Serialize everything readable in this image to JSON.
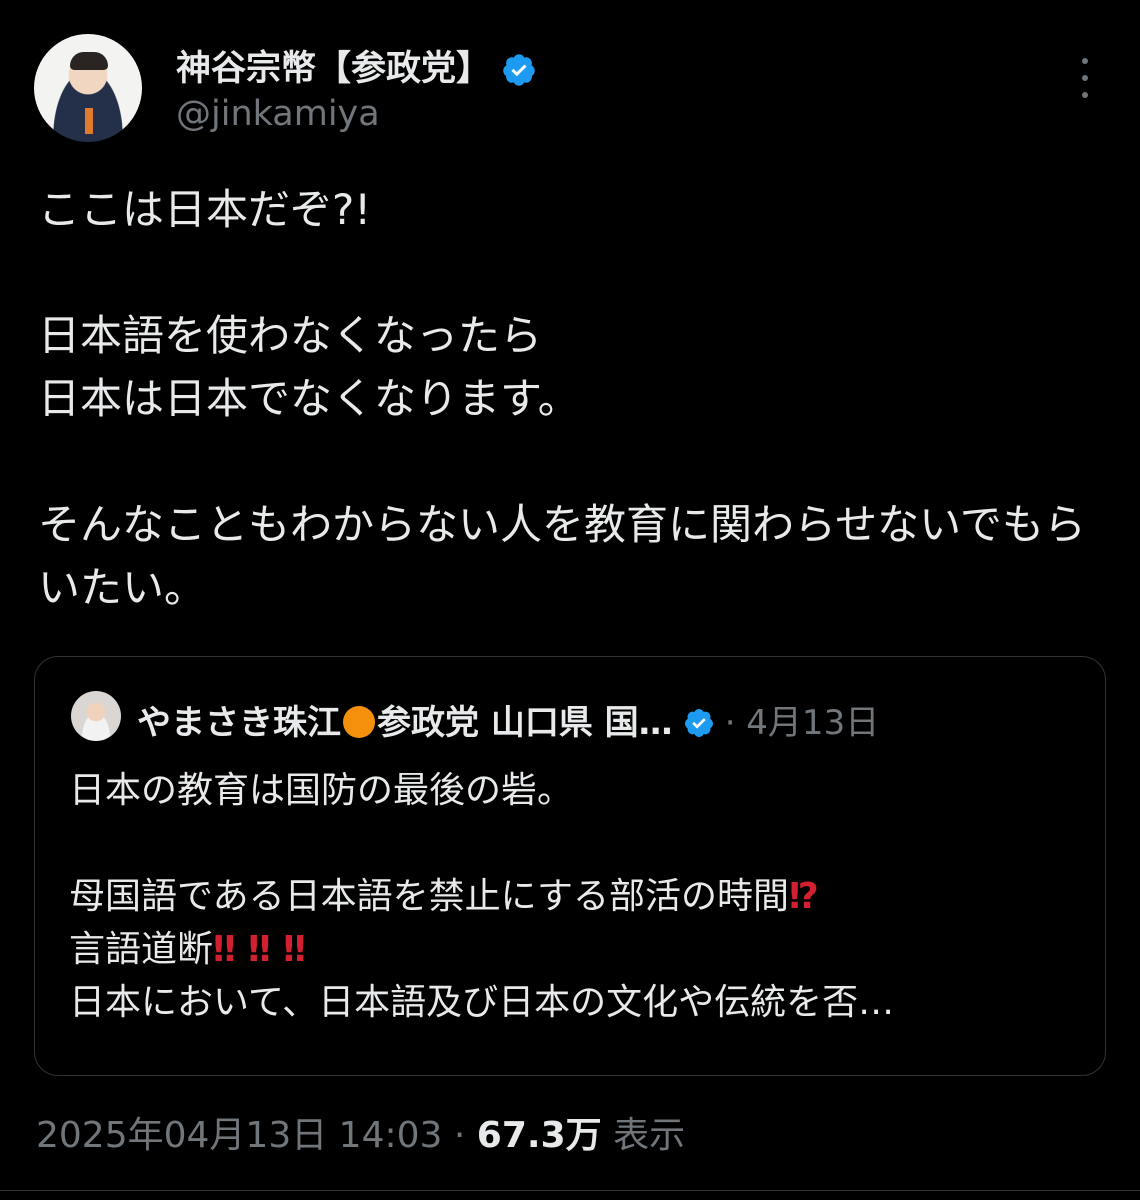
{
  "author": {
    "display_name": "神谷宗幣【参政党】",
    "handle": "@jinkamiya",
    "verified": true,
    "verified_color": "#1d9bf0"
  },
  "tweet": {
    "text": "ここは日本だぞ?!\n\n日本語を使わなくなったら\n日本は日本でなくなります。\n\nそんなこともわからない人を教育に関わらせないでもらいたい。"
  },
  "quoted": {
    "display_name_part1": "やまさき珠江",
    "display_name_part2": "参政党 山口県 国…",
    "date": "· 4月13日",
    "line1": "日本の教育は国防の最後の砦。",
    "line2": "母国語である日本語を禁止にする部活の時間",
    "line2_emoji": "⁉",
    "line3": "言語道断",
    "line3_emoji": "‼ ‼ ‼",
    "line4": "日本において、日本語及び日本の文化や伝統を否…"
  },
  "meta": {
    "timestamp": "2025年04月13日 14:03",
    "separator": "·",
    "views_count": "67.3万",
    "views_label": "表示"
  },
  "icons": {
    "more": "more-vertical-icon",
    "verified": "verified-badge-icon"
  }
}
